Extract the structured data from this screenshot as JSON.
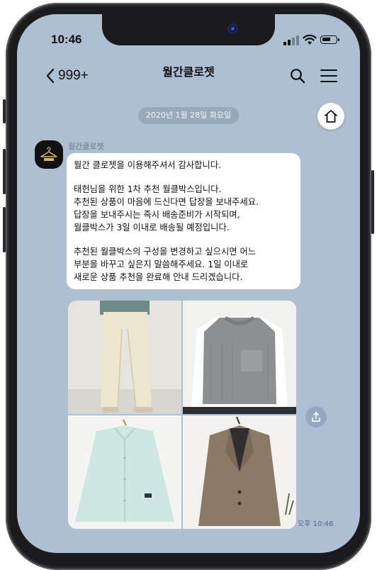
{
  "status_bar": {
    "time": "10:46"
  },
  "header": {
    "back_count": "999+",
    "title": "월간클로젯"
  },
  "chat": {
    "date_separator": "2020년 1월 28일 화요일",
    "sender_name": "월간클로젯",
    "message_lines": [
      "월간 클로젯을 이용해주셔서 감사합니다.",
      "",
      "태헌님을 위한 1차 추천 월클박스입니다.",
      "추천된 상품이 마음에 드신다면 답장을 보내주세요.",
      "답장을 보내주시는 즉시 배송준비가 시작되며,",
      "월클박스가 3일 이내로 배송될 예정입니다.",
      "",
      "추천된 월클박스의 구성을 변경하고 싶으시면 어느",
      "부분을 바꾸고 싶은지 말씀해주세요. 1일 이내로",
      "새로운 상품 추천을 완료해 안내 드리겠습니다."
    ],
    "timestamp": "오후 10:46"
  },
  "icons": {
    "back": "chevron-left-icon",
    "search": "search-icon",
    "menu": "hamburger-menu-icon",
    "home": "home-icon",
    "share": "share-icon",
    "avatar": "hanger-logo-icon"
  },
  "colors": {
    "chat_background": "#aebfd4",
    "bubble": "#ffffff",
    "date_pill": "#98a9bd"
  }
}
